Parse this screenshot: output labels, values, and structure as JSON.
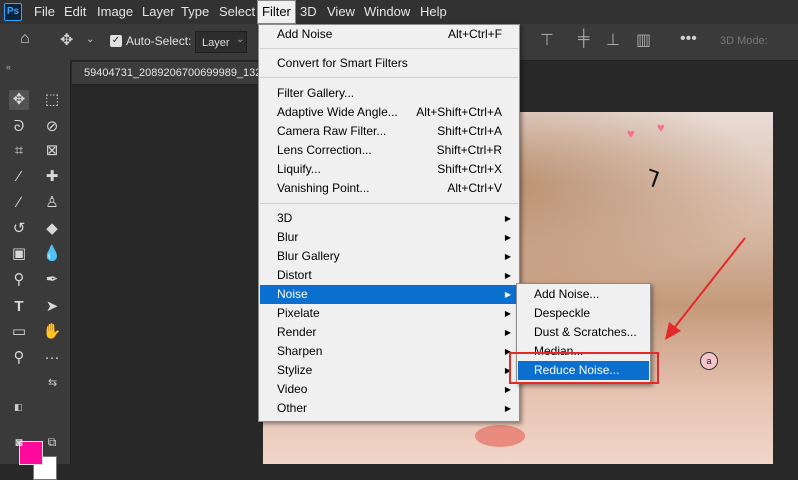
{
  "menubar": {
    "logo": "Ps",
    "items": [
      "File",
      "Edit",
      "Image",
      "Layer",
      "Type",
      "Select",
      "Filter",
      "3D",
      "View",
      "Window",
      "Help"
    ]
  },
  "options": {
    "auto_select_label": "Auto-Select:",
    "layer_value": "Layer",
    "mode_3d": "3D Mode:"
  },
  "document": {
    "tab_title": "59404731_2089206700699989_132"
  },
  "colors": {
    "foreground": "#ff0a9a",
    "background": "#ffffff",
    "highlight": "#0a6fcf",
    "annotation": "#e52828"
  },
  "filter_menu": {
    "last_filter": {
      "label": "Add Noise",
      "shortcut": "Alt+Ctrl+F"
    },
    "convert": "Convert for Smart Filters",
    "filters": [
      {
        "label": "Filter Gallery...",
        "shortcut": ""
      },
      {
        "label": "Adaptive Wide Angle...",
        "shortcut": "Alt+Shift+Ctrl+A"
      },
      {
        "label": "Camera Raw Filter...",
        "shortcut": "Shift+Ctrl+A"
      },
      {
        "label": "Lens Correction...",
        "shortcut": "Shift+Ctrl+R"
      },
      {
        "label": "Liquify...",
        "shortcut": "Shift+Ctrl+X"
      },
      {
        "label": "Vanishing Point...",
        "shortcut": "Alt+Ctrl+V"
      }
    ],
    "submenus": [
      "3D",
      "Blur",
      "Blur Gallery",
      "Distort",
      "Noise",
      "Pixelate",
      "Render",
      "Sharpen",
      "Stylize",
      "Video",
      "Other"
    ],
    "highlighted": "Noise"
  },
  "noise_menu": {
    "items": [
      "Add Noise...",
      "Despeckle",
      "Dust & Scratches...",
      "Median...",
      "Reduce Noise..."
    ],
    "highlighted": "Reduce Noise..."
  }
}
